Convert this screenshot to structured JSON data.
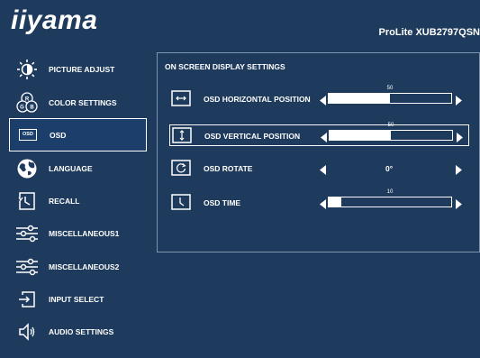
{
  "header": {
    "logo": "iiyama",
    "model": "ProLite XUB2797QSN"
  },
  "sidebar": {
    "items": [
      {
        "label": "PICTURE ADJUST",
        "icon": "brightness-icon"
      },
      {
        "label": "COLOR SETTINGS",
        "icon": "rgb-icon"
      },
      {
        "label": "OSD",
        "icon": "osd-icon",
        "icon_text": "OSD",
        "active": true
      },
      {
        "label": "LANGUAGE",
        "icon": "globe-icon"
      },
      {
        "label": "RECALL",
        "icon": "recall-icon"
      },
      {
        "label": "MISCELLANEOUS1",
        "icon": "sliders-icon"
      },
      {
        "label": "MISCELLANEOUS2",
        "icon": "sliders-icon"
      },
      {
        "label": "INPUT SELECT",
        "icon": "input-icon"
      },
      {
        "label": "AUDIO SETTINGS",
        "icon": "speaker-icon"
      }
    ]
  },
  "panel": {
    "title": "ON SCREEN DISPLAY SETTINGS",
    "rows": [
      {
        "label": "OSD HORIZONTAL POSITION",
        "type": "slider",
        "value": 50,
        "value_text": "50",
        "active": false
      },
      {
        "label": "OSD VERTICAL POSITION",
        "type": "slider",
        "value": 50,
        "value_text": "50",
        "active": true
      },
      {
        "label": "OSD ROTATE",
        "type": "option",
        "value_text": "0°",
        "active": false
      },
      {
        "label": "OSD TIME",
        "type": "slider",
        "value": 10,
        "value_text": "10",
        "active": false
      }
    ]
  },
  "colors": {
    "background": "#1e3a5c",
    "highlight": "#1b3e6a",
    "text": "#ffffff"
  }
}
